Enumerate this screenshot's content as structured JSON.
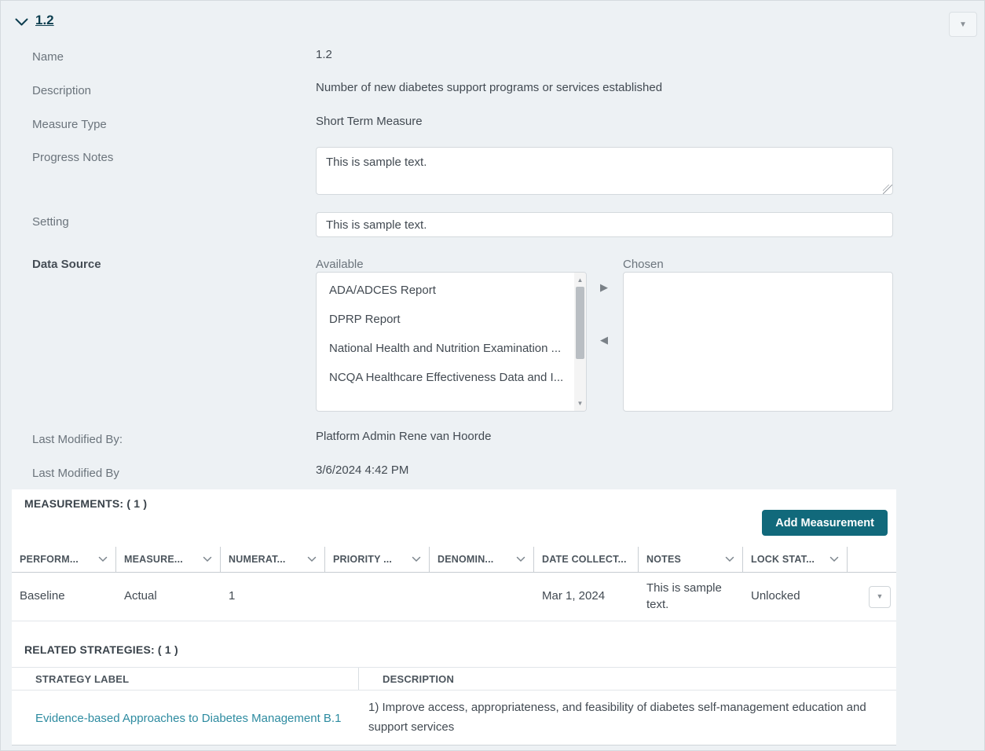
{
  "colors": {
    "page_bg": "#edf1f4",
    "title_teal": "#0d3e4f",
    "button_teal": "#11697b",
    "link_teal": "#2d8ba0"
  },
  "icons": {
    "caret_down": "▼",
    "caret_up": "▲",
    "caret_right": "▶",
    "caret_left": "◀"
  },
  "header": {
    "title": "1.2"
  },
  "form": {
    "name": {
      "label": "Name",
      "value": "1.2"
    },
    "description": {
      "label": "Description",
      "value": "Number of new diabetes support programs or services established"
    },
    "measure_type": {
      "label": "Measure Type",
      "value": "Short Term Measure"
    },
    "progress_notes": {
      "label": "Progress Notes",
      "value": "This is sample text."
    },
    "setting": {
      "label": "Setting",
      "value": "This is sample text."
    },
    "data_source": {
      "label": "Data Source",
      "available_label": "Available",
      "chosen_label": "Chosen",
      "available_options": [
        "ADA/ADCES Report",
        "DPRP Report",
        "National Health and Nutrition Examination ...",
        "NCQA Healthcare Effectiveness Data and I..."
      ],
      "chosen_options": []
    },
    "last_modified_by_name": {
      "label": "Last Modified By:",
      "value": "Platform Admin Rene van Hoorde"
    },
    "last_modified_by_date": {
      "label": "Last Modified By",
      "value": "3/6/2024 4:42 PM"
    }
  },
  "measurements": {
    "title": "MEASUREMENTS: ( 1 )",
    "add_button_label": "Add Measurement",
    "columns": [
      {
        "label": "PERFORM..."
      },
      {
        "label": "MEASURE..."
      },
      {
        "label": "NUMERAT..."
      },
      {
        "label": "PRIORITY ..."
      },
      {
        "label": "DENOMIN..."
      },
      {
        "label": "DATE COLLECT..."
      },
      {
        "label": "NOTES"
      },
      {
        "label": "LOCK STAT..."
      }
    ],
    "row": {
      "performance": "Baseline",
      "measure": "Actual",
      "numerator": "1",
      "priority": "",
      "denominator": "",
      "date_collected": "Mar 1, 2024",
      "notes": "This is sample text.",
      "lock_status": "Unlocked"
    }
  },
  "related_strategies": {
    "title": "RELATED STRATEGIES: ( 1 )",
    "columns": {
      "strategy_label": "STRATEGY LABEL",
      "description": "DESCRIPTION"
    },
    "rows": [
      {
        "label": "Evidence-based Approaches to Diabetes Management B.1",
        "description": "1) Improve access, appropriateness, and feasibility of diabetes self-management education and support services"
      }
    ]
  }
}
